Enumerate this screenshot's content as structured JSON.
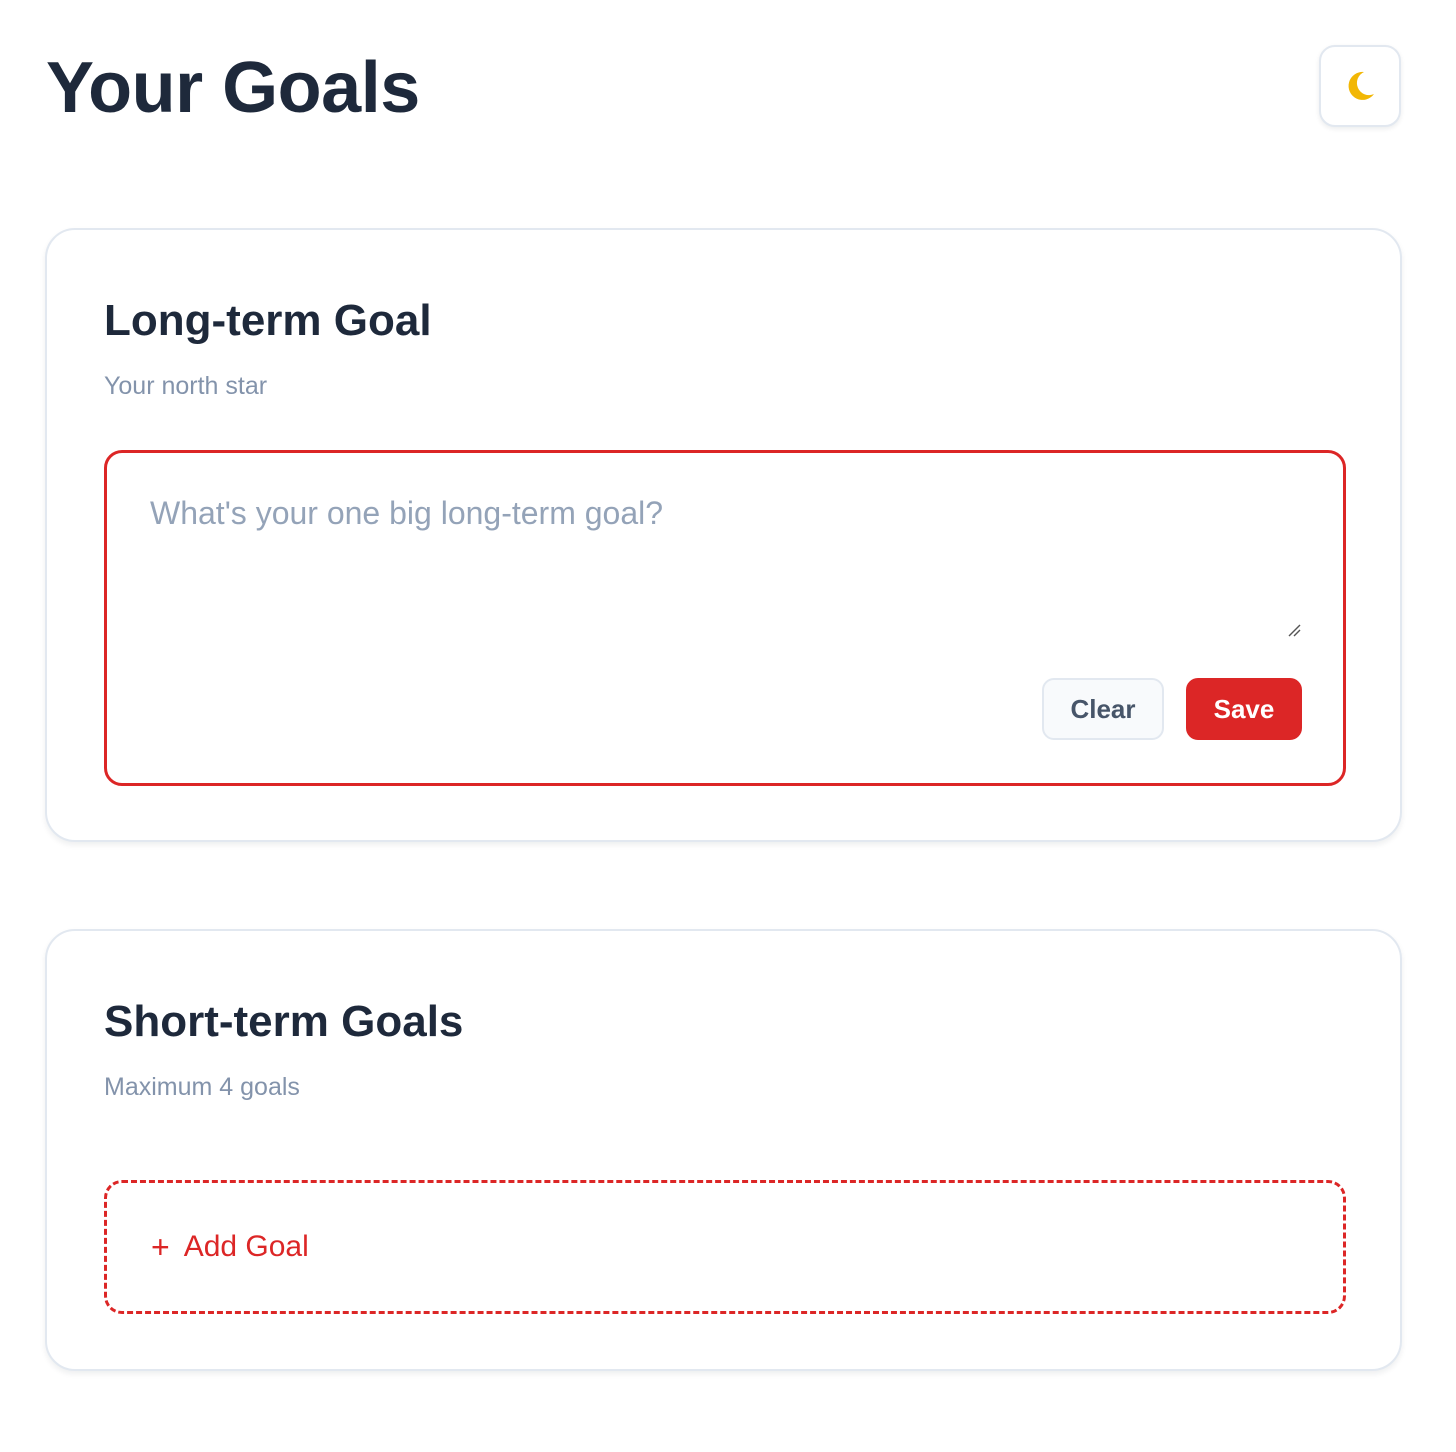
{
  "page": {
    "title": "Your Goals"
  },
  "theme_toggle": {
    "icon": "crescent-moon-icon",
    "color": "#f2b705"
  },
  "long_term": {
    "title": "Long-term Goal",
    "subtitle": "Your north star",
    "textarea": {
      "value": "",
      "placeholder": "What's your one big long-term goal?"
    },
    "clear_label": "Clear",
    "save_label": "Save"
  },
  "short_term": {
    "title": "Short-term Goals",
    "subtitle": "Maximum 4 goals",
    "add_icon": "+",
    "add_label": "Add Goal"
  },
  "colors": {
    "accent": "#dc2626",
    "heading": "#1e293b",
    "muted": "#8393ab",
    "border": "#e2e8f0"
  }
}
